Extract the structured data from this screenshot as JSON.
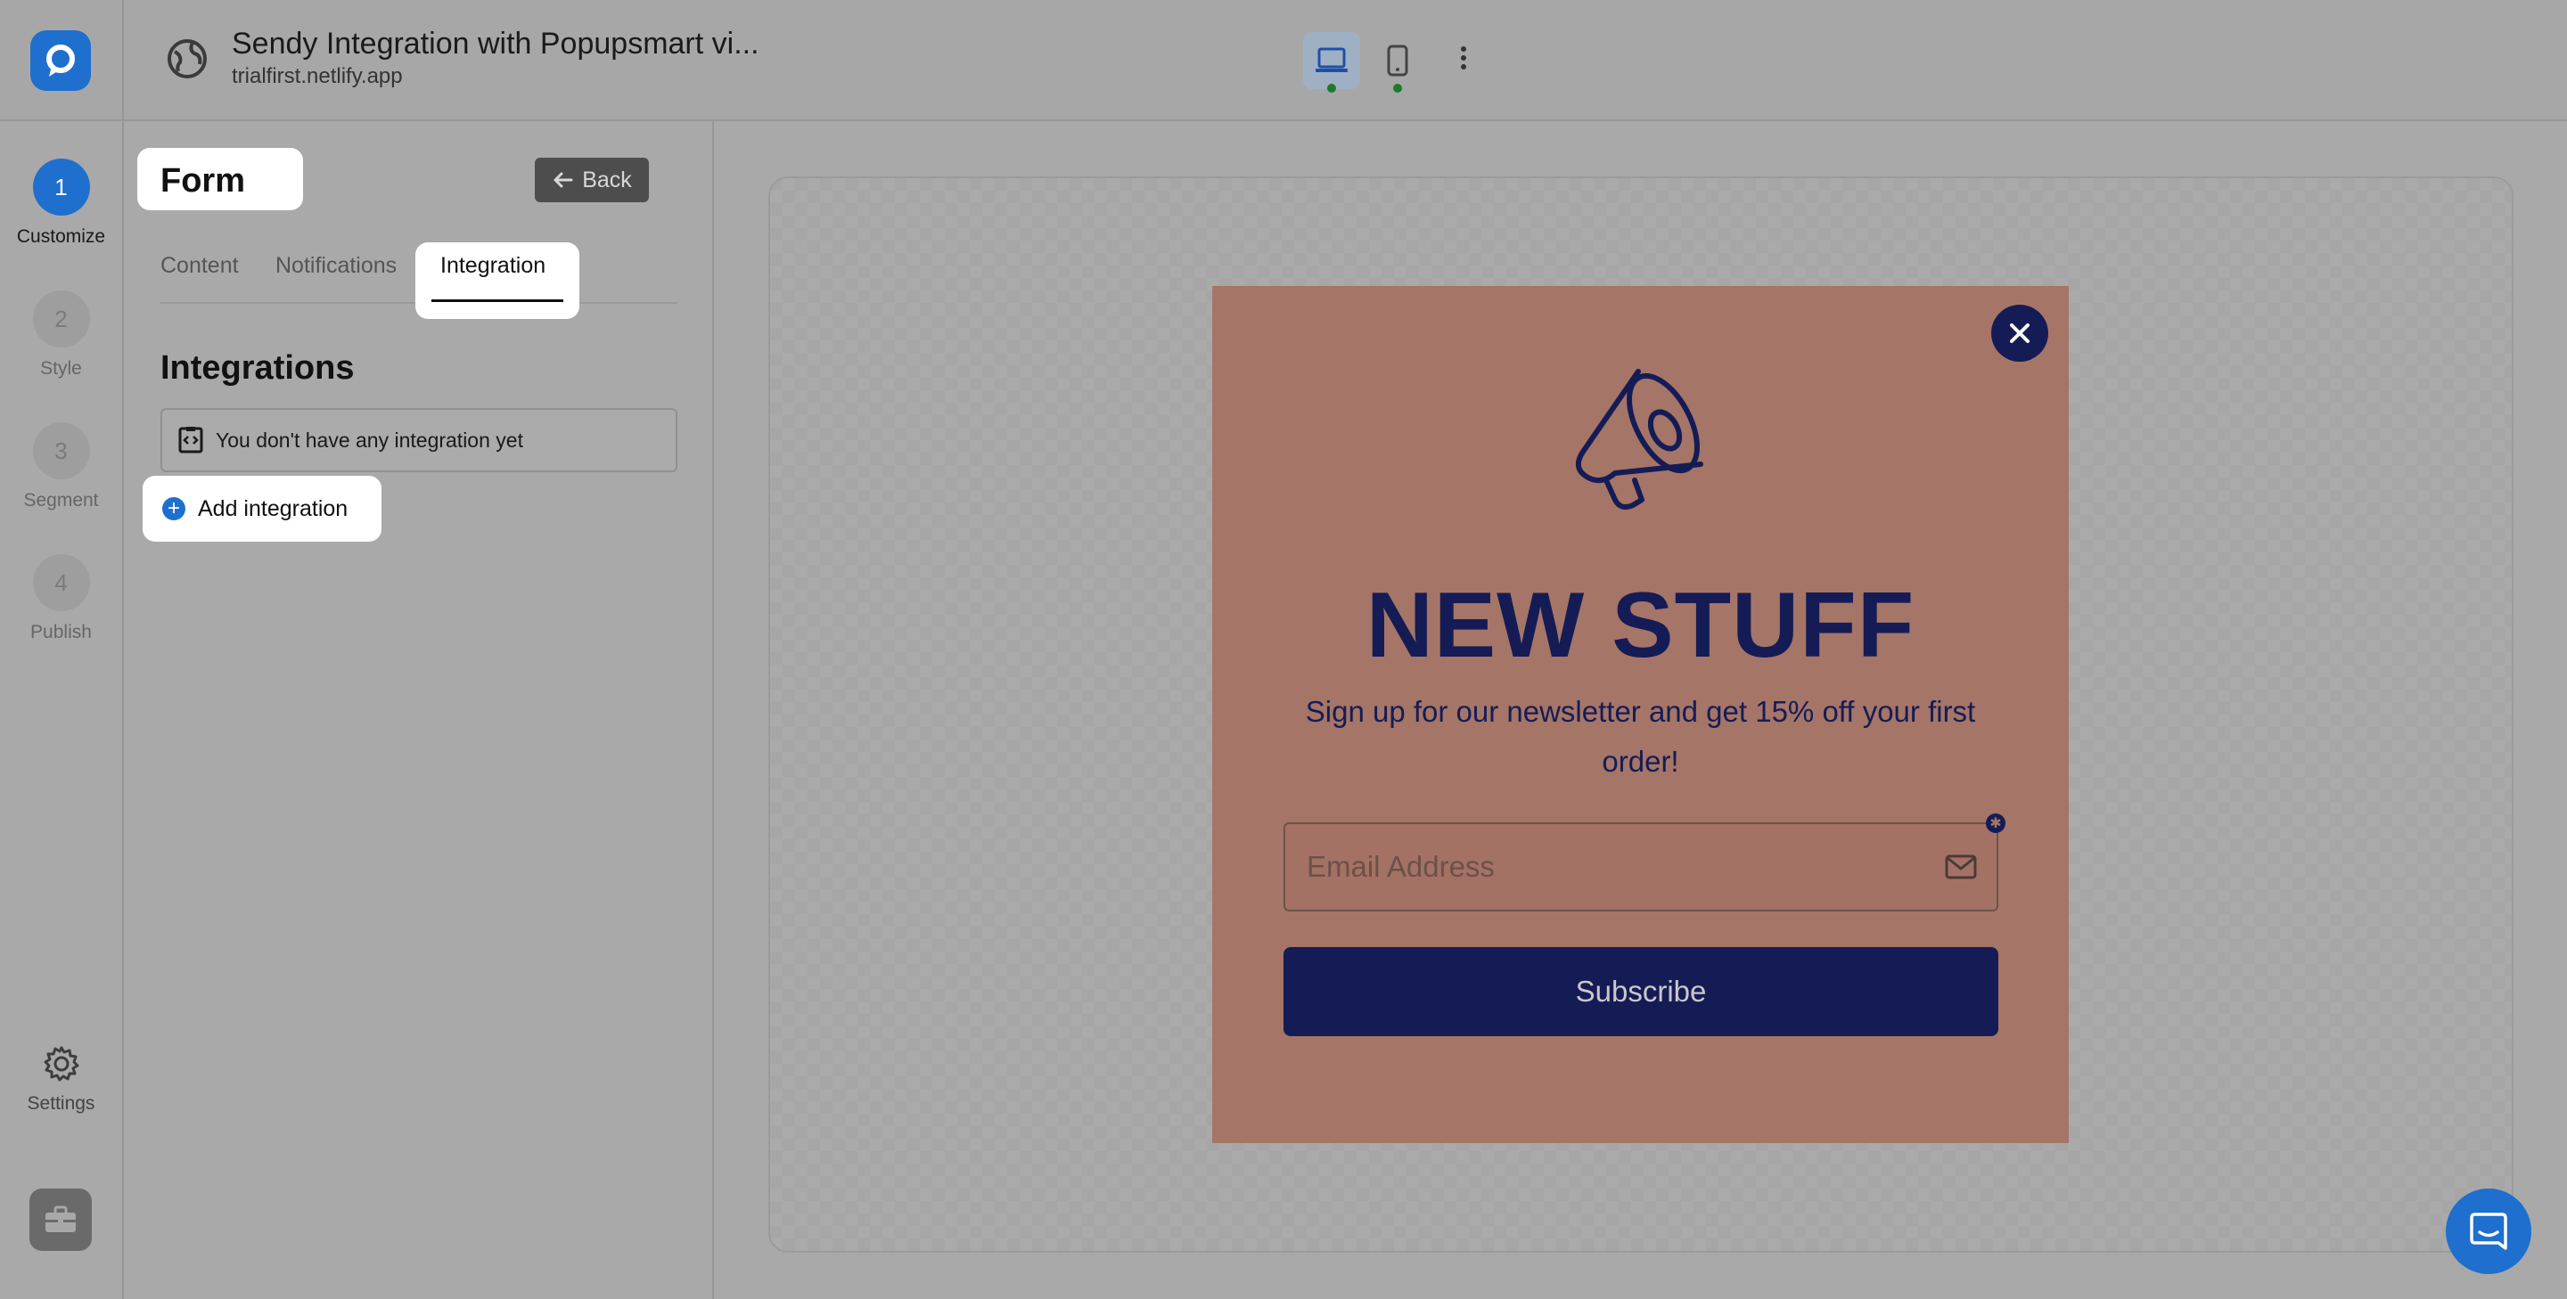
{
  "header": {
    "title": "Sendy Integration with Popupsmart vi...",
    "url": "trialfirst.netlify.app"
  },
  "steps": [
    {
      "number": "1",
      "label": "Customize",
      "active": true
    },
    {
      "number": "2",
      "label": "Style",
      "active": false
    },
    {
      "number": "3",
      "label": "Segment",
      "active": false
    },
    {
      "number": "4",
      "label": "Publish",
      "active": false
    }
  ],
  "rail": {
    "settings_label": "Settings"
  },
  "panel": {
    "title": "Form",
    "back_label": "Back",
    "tabs": [
      {
        "label": "Content",
        "active": false
      },
      {
        "label": "Notifications",
        "active": false
      },
      {
        "label": "Integration",
        "active": true
      }
    ],
    "section_title": "Integrations",
    "empty_message": "You don't have any integration yet",
    "add_label": "Add integration"
  },
  "popup": {
    "headline": "NEW STUFF",
    "subtext": "Sign up for our newsletter and get 15% off your first order!",
    "email_placeholder": "Email Address",
    "required_marker": "✱",
    "subscribe_label": "Subscribe"
  },
  "colors": {
    "brand": "#1e6fce",
    "popup_bg": "#a57567",
    "popup_ink": "#151c55"
  },
  "icons": [
    "logo-icon",
    "globe-icon",
    "desktop-icon",
    "mobile-icon",
    "more-vertical-icon",
    "gear-icon",
    "briefcase-icon",
    "arrow-left-icon",
    "code-file-icon",
    "plus-icon",
    "close-icon",
    "megaphone-icon",
    "mail-icon",
    "chat-icon"
  ]
}
